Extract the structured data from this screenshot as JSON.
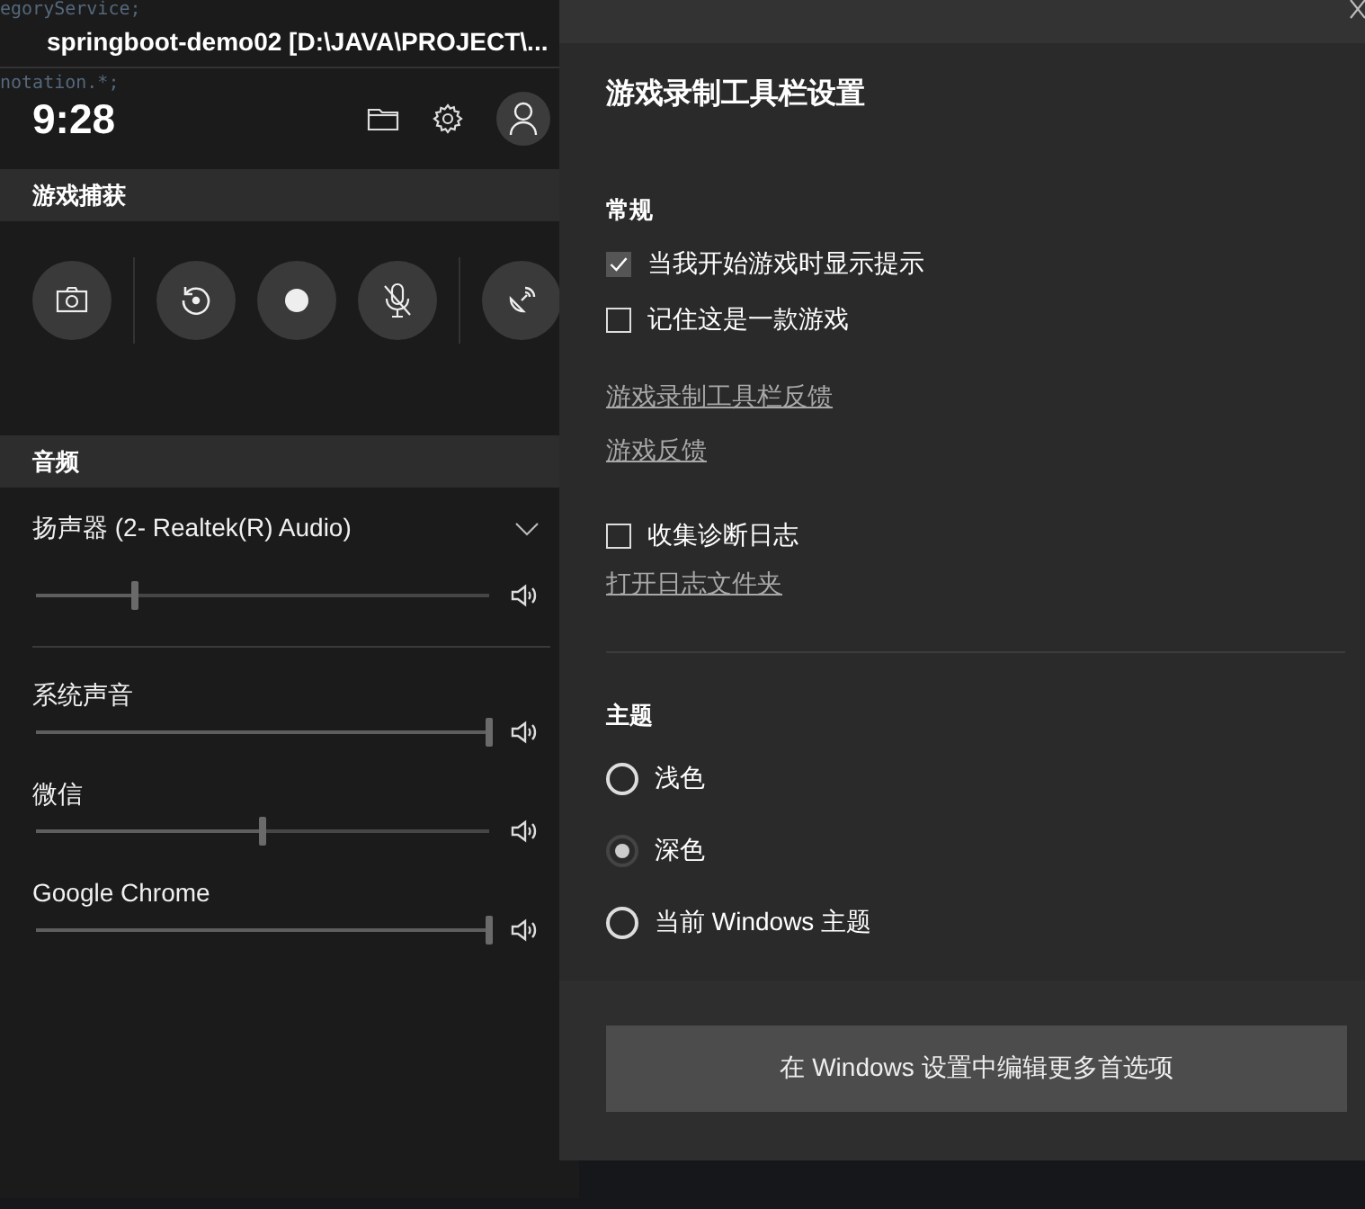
{
  "background_code": [
    "egoryService;",
    "notation.*;"
  ],
  "window": {
    "title": "springboot-demo02 [D:\\JAVA\\PROJECT\\..."
  },
  "game_bar": {
    "time": "9:28",
    "capture": {
      "header": "游戏捕获",
      "microphone_on": false
    },
    "audio": {
      "header": "音频",
      "device": {
        "name": "扬声器 (2- Realtek(R) Audio)",
        "level": 0.22
      },
      "apps": [
        {
          "name": "系统声音",
          "level": 1
        },
        {
          "name": "微信",
          "level": 0.5
        },
        {
          "name": "Google Chrome",
          "level": 1
        }
      ]
    }
  },
  "settings": {
    "title": "游戏录制工具栏设置",
    "general": {
      "header": "常规",
      "options": [
        {
          "label": "当我开始游戏时显示提示",
          "checked": true
        },
        {
          "label": "记住这是一款游戏",
          "checked": false
        }
      ]
    },
    "links": [
      "游戏录制工具栏反馈",
      "游戏反馈"
    ],
    "diagnostics": {
      "label": "收集诊断日志",
      "checked": false,
      "link": "打开日志文件夹"
    },
    "theme": {
      "header": "主题",
      "options": [
        {
          "label": "浅色",
          "selected": false
        },
        {
          "label": "深色",
          "selected": true
        },
        {
          "label": "当前 Windows 主题",
          "selected": false
        }
      ]
    },
    "button": "在 Windows 设置中编辑更多首选项"
  }
}
